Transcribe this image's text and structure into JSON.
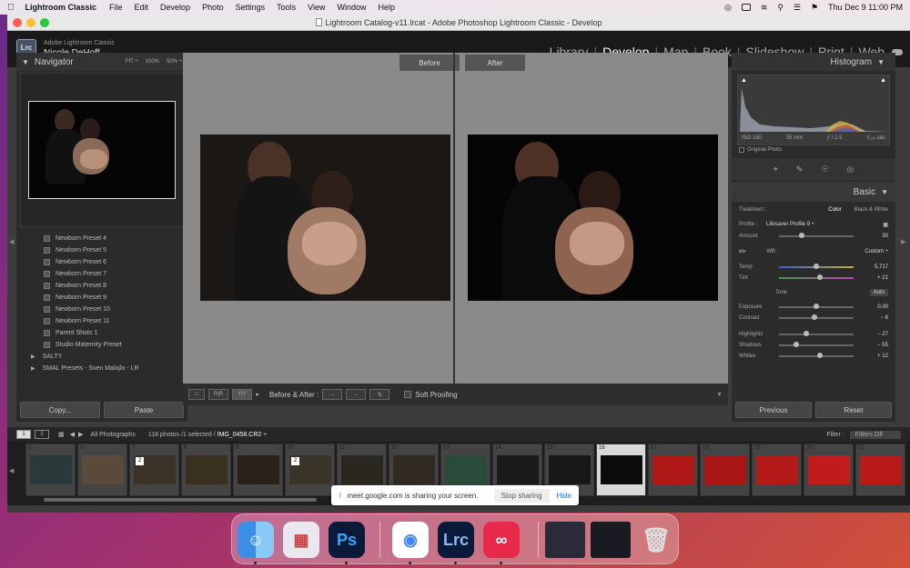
{
  "menubar": {
    "app": "Lightroom Classic",
    "items": [
      "File",
      "Edit",
      "Develop",
      "Photo",
      "Settings",
      "Tools",
      "View",
      "Window",
      "Help"
    ],
    "datetime": "Thu Dec 9  11:00 PM"
  },
  "window": {
    "title": "Lightroom Catalog-v11.lrcat - Adobe Photoshop Lightroom Classic - Develop"
  },
  "identity": {
    "badge": "Lrc",
    "app_name": "Adobe Lightroom Classic",
    "user": "Nicole DeHoff"
  },
  "modules": {
    "items": [
      "Library",
      "Develop",
      "Map",
      "Book",
      "Slideshow",
      "Print",
      "Web"
    ],
    "active": "Develop"
  },
  "navigator": {
    "title": "Navigator",
    "zoom": [
      "FIT ÷",
      "100%",
      "50% ÷"
    ]
  },
  "presets": [
    "Newborn Preset 4",
    "Newborn Preset 5",
    "Newborn Preset 6",
    "Newborn Preset 7",
    "Newborn Preset 8",
    "Newborn Preset 9",
    "Newborn Preset 10",
    "Newborn Preset 11",
    "Parent Shots 1",
    "Studio Maternity Preset"
  ],
  "preset_groups": [
    "SALTY",
    "SMAL Presets - Sven Malojlo - LR"
  ],
  "left_buttons": {
    "copy": "Copy...",
    "paste": "Paste"
  },
  "view": {
    "before": "Before",
    "after": "After"
  },
  "toolbar": {
    "yy": "Y|Y",
    "before_after": "Before & After :",
    "soft_proofing": "Soft Proofing"
  },
  "histogram": {
    "title": "Histogram",
    "iso": "ISO 160",
    "focal": "35 mm",
    "aperture": "ƒ / 2.5",
    "shutter": "¹⁄₁₂₅ sec",
    "original_photo": "Original Photo"
  },
  "basic": {
    "title": "Basic",
    "treatment_label": "Treatment :",
    "treatment_color": "Color",
    "treatment_bw": "Black & White",
    "profile_label": "Profile :",
    "profile_value": "Lifesaver Profile 9 ÷",
    "amount_label": "Amount",
    "amount_value": "30",
    "amount_level": 0.3,
    "wb_label": "WB :",
    "wb_value": "Custom ÷",
    "temp_label": "Temp",
    "temp_value": "5,717",
    "temp_level": 0.5,
    "tint_label": "Tint",
    "tint_value": "+ 21",
    "tint_level": 0.55,
    "tone_label": "Tone",
    "tone_auto": "Auto",
    "exposure_label": "Exposure",
    "exposure_value": "0.00",
    "exposure_level": 0.5,
    "contrast_label": "Contrast",
    "contrast_value": "− 6",
    "contrast_level": 0.48,
    "highlights_label": "Highlights",
    "highlights_value": "− 27",
    "highlights_level": 0.37,
    "shadows_label": "Shadows",
    "shadows_value": "− 55",
    "shadows_level": 0.23,
    "whites_label": "Whites",
    "whites_value": "+ 12",
    "whites_level": 0.55
  },
  "right_buttons": {
    "previous": "Previous",
    "reset": "Reset"
  },
  "filmstrip": {
    "pages": [
      "1",
      "2"
    ],
    "source": "All Photographs",
    "count": "118 photos /1 selected /",
    "file": "IMG_0458.CR2 ÷",
    "filter_label": "Filter :",
    "filter_value": "Filters Off",
    "thumbs": [
      "5",
      "6",
      "7",
      "8",
      "9",
      "10",
      "11",
      "12",
      "13",
      "14",
      "15",
      "16",
      "17",
      "18",
      "19",
      "20",
      "21"
    ],
    "badge": "2"
  },
  "share": {
    "message": "meet.google.com is sharing your screen.",
    "stop": "Stop sharing",
    "hide": "Hide"
  },
  "dock": {
    "ps": "Ps",
    "lrc": "Lrc"
  }
}
